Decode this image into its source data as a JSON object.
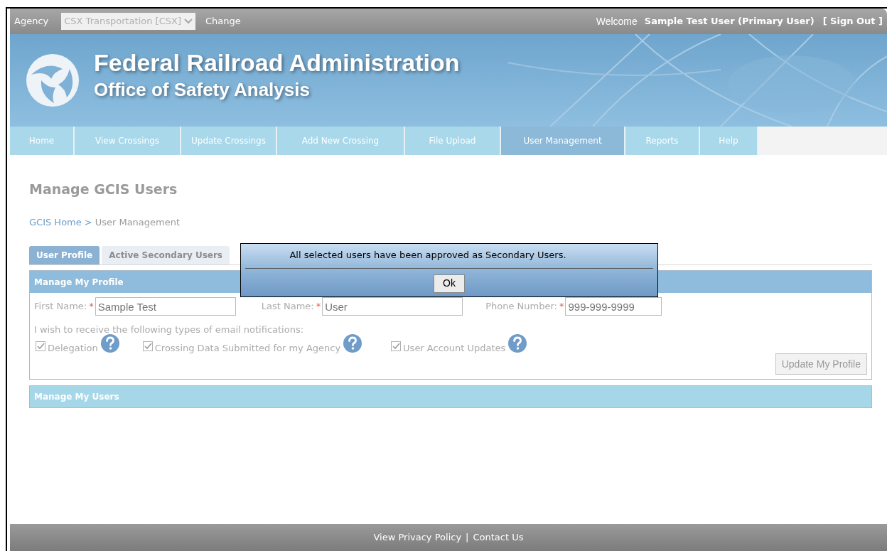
{
  "top_bar": {
    "agency_label": "Agency",
    "agency_select": "CSX Transportation [CSX]",
    "change_link": "Change",
    "welcome": "Welcome",
    "user": "Sample Test User (Primary User)",
    "sign_out": "[ Sign Out ]"
  },
  "banner": {
    "title": "Federal Railroad Administration",
    "subtitle": "Office of Safety Analysis"
  },
  "nav": [
    {
      "label": "Home",
      "selected": false
    },
    {
      "label": "View Crossings",
      "selected": false
    },
    {
      "label": "Update Crossings",
      "selected": false
    },
    {
      "label": "Add New Crossing",
      "selected": false
    },
    {
      "label": "File Upload",
      "selected": false
    },
    {
      "label": "User Management",
      "selected": true
    },
    {
      "label": "Reports",
      "selected": false
    },
    {
      "label": "Help",
      "selected": false
    }
  ],
  "page_title": "Manage GCIS Users",
  "breadcrumb": {
    "link": "GCIS Home",
    "separator": ">",
    "current": "User Management"
  },
  "tabs": [
    {
      "label": "User Profile",
      "selected": true
    },
    {
      "label": "Active Secondary Users",
      "selected": false
    }
  ],
  "profile_panel": {
    "title": "Manage My Profile",
    "fields": [
      {
        "label": "First Name:",
        "required": "*",
        "value": "Sample Test"
      },
      {
        "label": "Last Name:",
        "required": "*",
        "value": "User"
      },
      {
        "label": "Phone Number:",
        "required": "*",
        "value": "999-999-9999"
      }
    ],
    "notifications_label": "I wish to receive the following types of email notifications:",
    "notifications": [
      {
        "label": "Delegation",
        "checked": true
      },
      {
        "label": "Crossing Data Submitted for my Agency",
        "checked": true
      },
      {
        "label": "User Account Updates",
        "checked": true
      }
    ],
    "update_button": "Update My Profile"
  },
  "users_panel": {
    "title": "Manage My Users"
  },
  "dialog": {
    "message": "All selected users have been approved as Secondary Users.",
    "button": "Ok"
  },
  "footer": {
    "links": [
      "View Privacy Policy",
      "Contact Us"
    ],
    "separator": "|"
  }
}
